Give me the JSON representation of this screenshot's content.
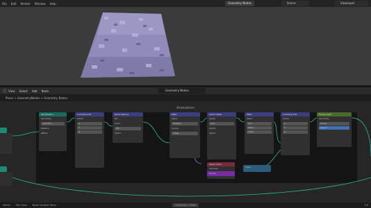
{
  "topbar": {
    "menu": [
      "File",
      "Edit",
      "Render",
      "Window",
      "Help"
    ],
    "active_tab": "Geometry Nodes",
    "scene": "Scene",
    "view_layer": "ViewLayer"
  },
  "editor_header": {
    "menu": [
      "View",
      "Select",
      "Add",
      "Node"
    ],
    "node_tree": "Geometry Nodes"
  },
  "breadcrumb": "Plane > GeometryNodes > Geometry Nodes",
  "frame": {
    "label": "Animation"
  },
  "nodes": [
    {
      "title": "Set Position",
      "kind": "geo",
      "rows": [
        "Geometry",
        "Selection",
        "Position",
        "Offset"
      ]
    },
    {
      "title": "Combine XYZ",
      "kind": "vec",
      "rows": [
        "Vector",
        "X",
        "Y",
        "Z"
      ]
    },
    {
      "title": "Noise Texture",
      "kind": "vec",
      "rows": [
        "Fac",
        "Color",
        "3D",
        "Vector",
        "Scale",
        "Detail"
      ]
    },
    {
      "title": "Math",
      "kind": "vec",
      "rows": [
        "Value",
        "Multiply",
        "Clamp",
        "Value"
      ]
    },
    {
      "title": "Vector Math",
      "kind": "vec",
      "rows": [
        "Vector",
        "Add",
        "Vector",
        "Vector"
      ]
    },
    {
      "title": "Math",
      "kind": "vec",
      "rows": [
        "Value",
        "Add",
        "Value",
        "Value"
      ]
    },
    {
      "title": "Combine XYZ",
      "kind": "vec",
      "rows": [
        "Vector",
        "X",
        "Y",
        "Z"
      ]
    },
    {
      "title": "Group Input",
      "kind": "misc",
      "rows": [
        "Geometry",
        "Frame",
        "Speed"
      ]
    }
  ],
  "small_nodes": [
    {
      "title": "Scene Time",
      "rows": [
        "Seconds",
        "Frame"
      ]
    },
    {
      "title": "Value",
      "rows": [
        "Value"
      ]
    }
  ],
  "statusbar": {
    "items": [
      "Select",
      "Pan View",
      "Node Context Menu"
    ],
    "badge": "Collection | Plane",
    "version": "3.6"
  }
}
